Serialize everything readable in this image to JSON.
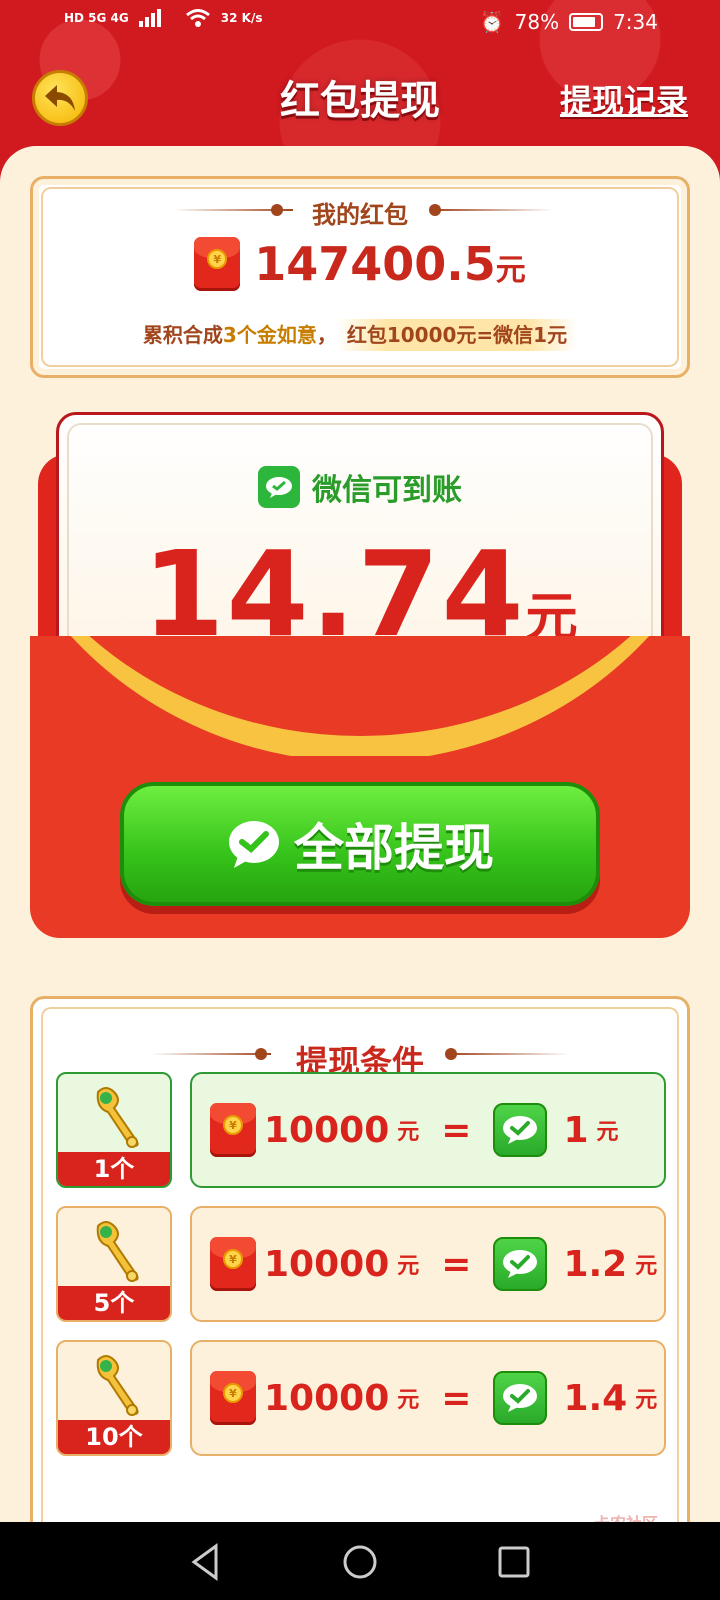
{
  "status_bar": {
    "network_left": "HD 5G 4G",
    "speed": "32 K/s",
    "battery": "78%",
    "time": "7:34"
  },
  "header": {
    "title": "红包提现",
    "records_label": "提现记录",
    "back_icon": "back-arrow-icon"
  },
  "my_packet": {
    "heading": "我的红包",
    "amount": "147400.5",
    "unit": "元",
    "rule_prefix": "累积合成",
    "rule_gold": "3个金如意",
    "rule_sep": "，",
    "rule_rate": "红包10000元=微信1元"
  },
  "envelope": {
    "wechat_label": "微信可到账",
    "amount": "14.74",
    "unit": "元",
    "button_label": "全部提现"
  },
  "conditions": {
    "heading": "提现条件",
    "rows": [
      {
        "count": "1个",
        "packet_value": "10000",
        "packet_unit": "元",
        "eq": "=",
        "wx_value": "1",
        "wx_unit": "元",
        "active": true
      },
      {
        "count": "5个",
        "packet_value": "10000",
        "packet_unit": "元",
        "eq": "=",
        "wx_value": "1.2",
        "wx_unit": "元",
        "active": false
      },
      {
        "count": "10个",
        "packet_value": "10000",
        "packet_unit": "元",
        "eq": "=",
        "wx_value": "1.4",
        "wx_unit": "元",
        "active": false
      }
    ]
  },
  "colors": {
    "brand_red": "#d01a1f",
    "cream": "#fdf1dc",
    "wechat_green": "#2db63c"
  }
}
